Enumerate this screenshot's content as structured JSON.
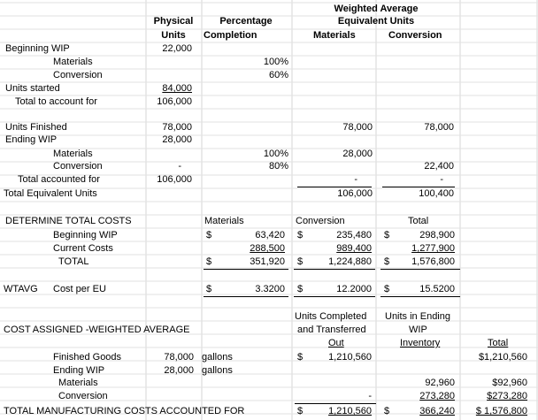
{
  "headers": {
    "weighted_average": "Weighted Average",
    "equivalent_units": "Equivalent Units",
    "physical": "Physical",
    "units": "Units",
    "percentage": "Percentage",
    "completion": "Completion",
    "materials": "Materials",
    "conversion": "Conversion"
  },
  "section1": {
    "beginning_wip": "Beginning WIP",
    "beginning_wip_units": "22,000",
    "materials": "Materials",
    "materials_pct": "100%",
    "conversion": "Conversion",
    "conversion_pct": "60%",
    "units_started": "Units started",
    "units_started_val": "84,000",
    "total_to_account": "Total to account for",
    "total_to_account_val": "106,000",
    "units_finished": "Units Finished",
    "units_finished_units": "78,000",
    "units_finished_mat": "78,000",
    "units_finished_conv": "78,000",
    "ending_wip": "Ending WIP",
    "ending_wip_units": "28,000",
    "end_materials": "Materials",
    "end_materials_pct": "100%",
    "end_materials_eu": "28,000",
    "end_conversion": "Conversion",
    "end_conversion_units": "-",
    "end_conversion_pct": "80%",
    "end_conversion_eu": "22,400",
    "total_accounted": "Total accounted for",
    "total_accounted_val": "106,000",
    "dash_mat": "-",
    "dash_conv": "-",
    "total_eu": "Total Equivalent Units",
    "total_eu_mat": "106,000",
    "total_eu_conv": "100,400"
  },
  "section2": {
    "title": "DETERMINE TOTAL COSTS",
    "col_materials": "Materials",
    "col_conversion": "Conversion",
    "col_total": "Total",
    "currency": "$",
    "beginning_wip": "Beginning WIP",
    "bw_mat": "63,420",
    "bw_conv": "235,480",
    "bw_total": "298,900",
    "current_costs": "Current Costs",
    "cc_mat": "288,500",
    "cc_conv": "989,400",
    "cc_total": "1,277,900",
    "total": "TOTAL",
    "t_mat": "351,920",
    "t_conv": "1,224,880",
    "t_total": "1,576,800"
  },
  "section3": {
    "wtavg": "WTAVG",
    "cost_per_eu": "Cost per EU",
    "currency": "$",
    "mat": "3.3200",
    "conv": "12.2000",
    "total": "15.5200"
  },
  "section4": {
    "title": "COST ASSIGNED -WEIGHTED AVERAGE",
    "h_completed_1": "Units Completed",
    "h_completed_2": "and Transferred",
    "h_completed_3": "Out",
    "h_ending_1": "Units in Ending",
    "h_ending_2": "WIP",
    "h_ending_3": "Inventory",
    "h_total": "Total",
    "currency": "$",
    "finished_goods": "Finished Goods",
    "fg_units": "78,000",
    "fg_unit_label": "gallons",
    "fg_completed": "1,210,560",
    "fg_total": "$1,210,560",
    "ending_wip": "Ending WIP",
    "ew_units": "28,000",
    "ew_unit_label": "gallons",
    "materials": "Materials",
    "mat_ending": "92,960",
    "mat_total": "$92,960",
    "conversion": "Conversion",
    "conv_completed": "-",
    "conv_ending": "273,280",
    "conv_total": "$273,280",
    "grand_label": "TOTAL MANUFACTURING COSTS ACCOUNTED FOR",
    "grand_completed": "1,210,560",
    "grand_ending": "366,240",
    "grand_total": "$ 1,576,800"
  }
}
